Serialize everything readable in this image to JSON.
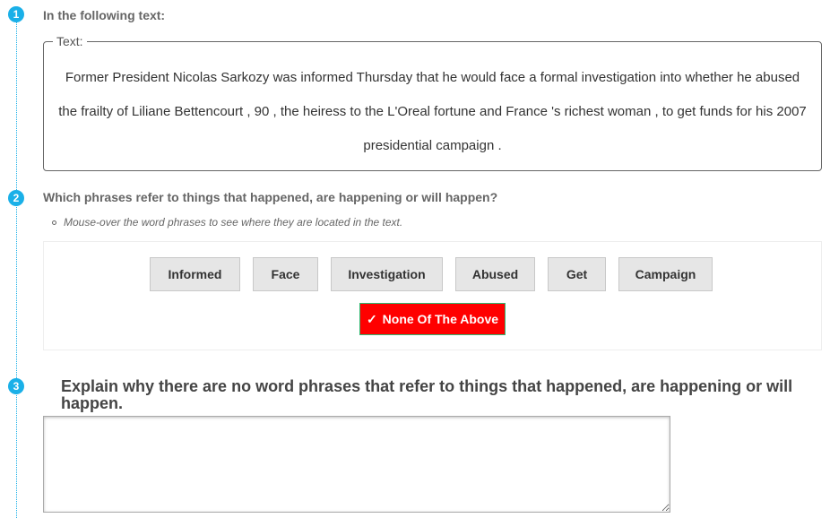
{
  "steps": [
    {
      "number": "1",
      "title": "In the following text:"
    },
    {
      "number": "2",
      "title": "Which phrases refer to things that happened, are happening or will happen?"
    },
    {
      "number": "3",
      "title": "Explain why there are no word phrases that refer to things that happened, are happening or will happen."
    }
  ],
  "text_box": {
    "legend": "Text:",
    "passage": "Former President Nicolas Sarkozy was informed Thursday that he would face a formal investigation into whether he abused the frailty of Liliane Bettencourt , 90 , the heiress to the L'Oreal fortune and France 's richest woman , to get funds for his 2007 presidential campaign ."
  },
  "hint": "Mouse-over the word phrases to see where they are located in the text.",
  "phrases": [
    "Informed",
    "Face",
    "Investigation",
    "Abused",
    "Get",
    "Campaign"
  ],
  "none_button": {
    "label": "None Of The Above",
    "icon": "check-icon",
    "selected": true
  },
  "answer": {
    "value": "",
    "placeholder": ""
  },
  "colors": {
    "accent": "#1ab0e8",
    "selected": "#ff0000",
    "selected_border": "#2eb872"
  }
}
